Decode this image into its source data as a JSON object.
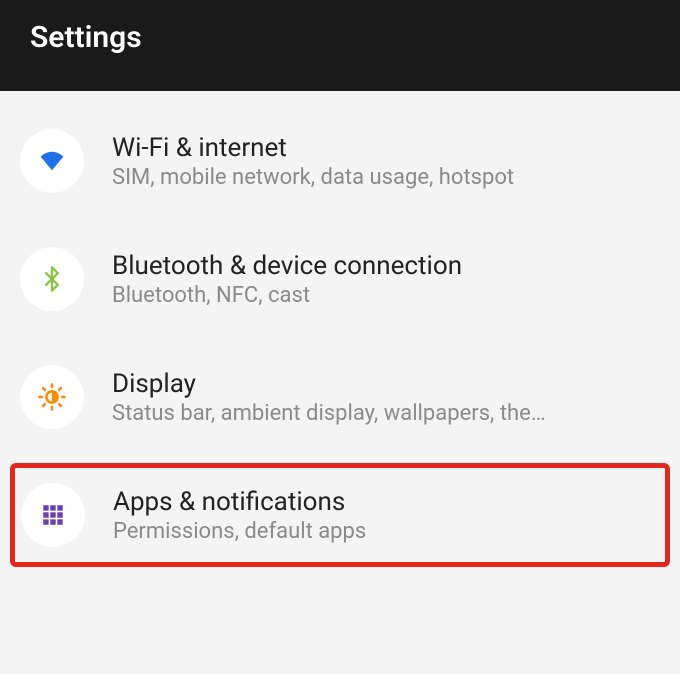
{
  "header": {
    "title": "Settings"
  },
  "items": [
    {
      "icon": "wifi",
      "title": "Wi-Fi & internet",
      "subtitle": "SIM, mobile network, data usage, hotspot",
      "highlighted": false
    },
    {
      "icon": "bluetooth",
      "title": "Bluetooth & device connection",
      "subtitle": "Bluetooth, NFC, cast",
      "highlighted": false
    },
    {
      "icon": "display",
      "title": "Display",
      "subtitle": "Status bar, ambient display, wallpapers, the…",
      "highlighted": false
    },
    {
      "icon": "apps",
      "title": "Apps & notifications",
      "subtitle": "Permissions, default apps",
      "highlighted": true
    }
  ],
  "colors": {
    "wifi": "#1f73e8",
    "bluetooth": "#8bc34a",
    "display": "#ff8a00",
    "apps": "#6a3db5",
    "highlight": "#e52620"
  }
}
